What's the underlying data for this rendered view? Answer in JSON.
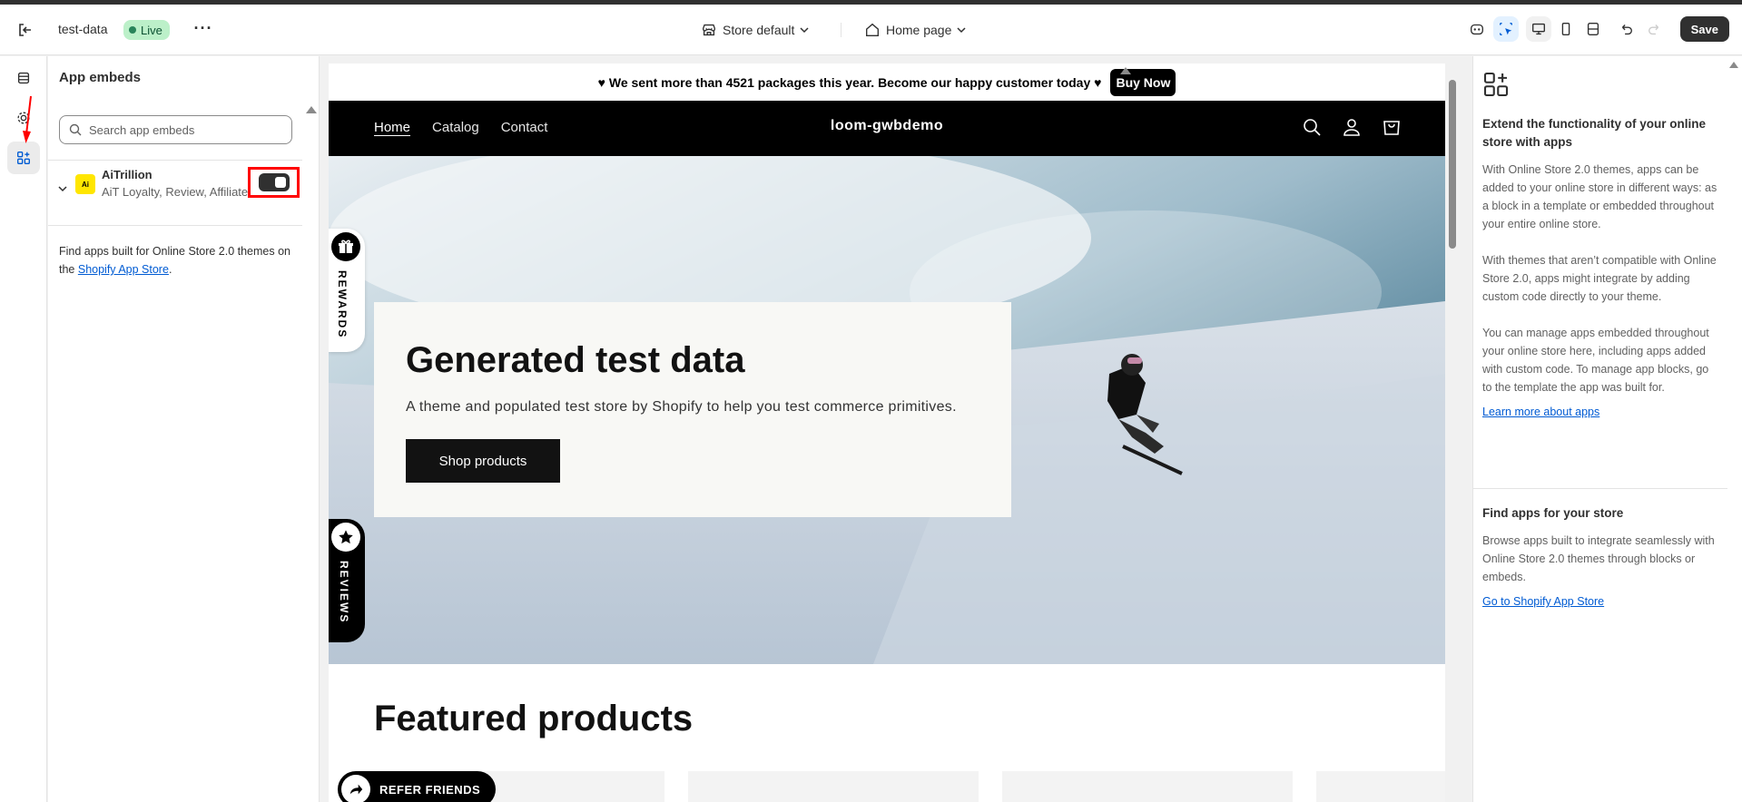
{
  "topbar": {
    "store_name": "test-data",
    "status_badge": "Live",
    "theme_selector": "Store default",
    "page_selector": "Home page",
    "save_label": "Save"
  },
  "sidebar": {
    "title": "App embeds",
    "search_placeholder": "Search app embeds",
    "app": {
      "name": "AiTrillion",
      "description": "AiT Loyalty, Review, Affiliate",
      "logo_text": "Ai",
      "enabled": true
    },
    "footer_text": "Find apps built for Online Store 2.0 themes on the ",
    "footer_link": "Shopify App Store",
    "footer_end": "."
  },
  "preview": {
    "announcement": "♥ We sent more than 4521 packages this year. Become our happy customer today ♥",
    "buy_now": "Buy Now",
    "nav": [
      "Home",
      "Catalog",
      "Contact"
    ],
    "brand": "loom-gwbdemo",
    "hero_title": "Generated test data",
    "hero_subtitle": "A theme and populated test store by Shopify to help you test commerce primitives.",
    "hero_button": "Shop products",
    "featured_title": "Featured products",
    "rewards_label": "REWARDS",
    "reviews_label": "REVIEWS",
    "refer_label": "REFER FRIENDS"
  },
  "right_panel": {
    "heading1": "Extend the functionality of your online store with apps",
    "p1": "With Online Store 2.0 themes, apps can be added to your online store in different ways: as a block in a template or embedded throughout your entire online store.",
    "p2": "With themes that aren’t compatible with Online Store 2.0, apps might integrate by adding custom code directly to your theme.",
    "p3": "You can manage apps embedded throughout your online store here, including apps added with custom code. To manage app blocks, go to the template the app was built for.",
    "link1": "Learn more about apps",
    "heading2": "Find apps for your store",
    "p4": "Browse apps built to integrate seamlessly with Online Store 2.0 themes through blocks or embeds.",
    "link2": "Go to Shopify App Store"
  },
  "colors": {
    "highlight": "#ff0000",
    "live_badge": "#bcf0c9",
    "link": "#005bd3"
  }
}
